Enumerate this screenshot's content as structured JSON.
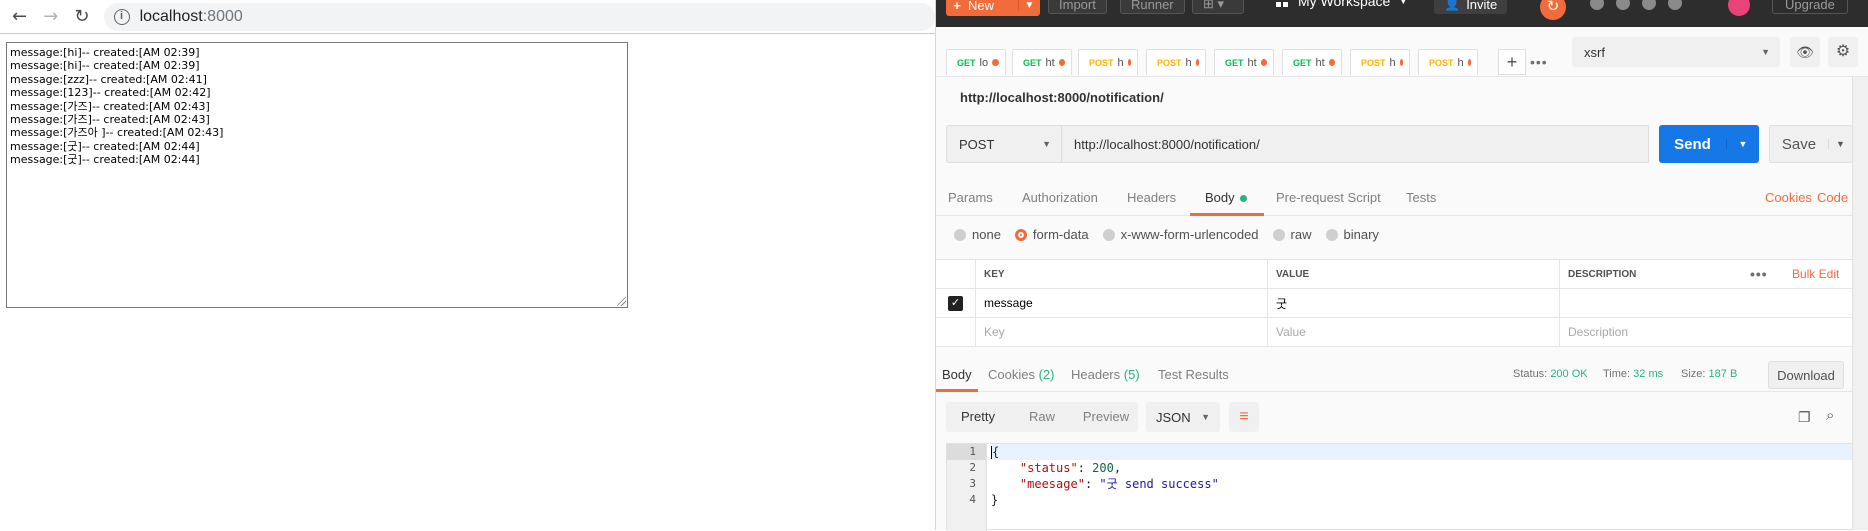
{
  "browser": {
    "url_host": "localhost",
    "url_port": ":8000",
    "messages": [
      "message:[hi]-- created:[AM 02:39]",
      "message:[hi]-- created:[AM 02:39]",
      "message:[zzz]-- created:[AM 02:41]",
      "message:[123]-- created:[AM 02:42]",
      "message:[가즈]-- created:[AM 02:43]",
      "message:[가즈]-- created:[AM 02:43]",
      "message:[가즈아 ]-- created:[AM 02:43]",
      "message:[굿]-- created:[AM 02:44]",
      "message:[굿]-- created:[AM 02:44]"
    ]
  },
  "postman": {
    "header": {
      "new_label": "New",
      "import_label": "Import",
      "runner_label": "Runner",
      "workspace_label": "My Workspace",
      "invite_label": "Invite",
      "upgrade_label": "Upgrade"
    },
    "tabs": [
      {
        "method": "GET",
        "title": "lo"
      },
      {
        "method": "GET",
        "title": "ht"
      },
      {
        "method": "POST",
        "title": "h"
      },
      {
        "method": "POST",
        "title": "h"
      },
      {
        "method": "GET",
        "title": "ht"
      },
      {
        "method": "GET",
        "title": "ht"
      },
      {
        "method": "POST",
        "title": "h"
      },
      {
        "method": "POST",
        "title": "h"
      }
    ],
    "environment": "xsrf",
    "request_name": "http://localhost:8000/notification/",
    "method": "POST",
    "url": "http://localhost:8000/notification/",
    "send_label": "Send",
    "save_label": "Save",
    "subtabs": {
      "params": "Params",
      "authorization": "Authorization",
      "headers": "Headers",
      "body": "Body",
      "prerequest": "Pre-request Script",
      "tests": "Tests",
      "cookies": "Cookies",
      "code": "Code"
    },
    "body_modes": {
      "none": "none",
      "form_data": "form-data",
      "urlencoded": "x-www-form-urlencoded",
      "raw": "raw",
      "binary": "binary"
    },
    "kv_table": {
      "head_key": "KEY",
      "head_value": "VALUE",
      "head_description": "DESCRIPTION",
      "bulk_edit": "Bulk Edit",
      "row_key": "message",
      "row_value": "굿",
      "placeholder_key": "Key",
      "placeholder_value": "Value",
      "placeholder_description": "Description"
    },
    "response": {
      "tab_body": "Body",
      "tab_cookies": "Cookies",
      "cookies_count": "(2)",
      "tab_headers": "Headers",
      "headers_count": "(5)",
      "tab_tests": "Test Results",
      "status_label": "Status:",
      "status_value": "200 OK",
      "time_label": "Time:",
      "time_value": "32 ms",
      "size_label": "Size:",
      "size_value": "187 B",
      "download_label": "Download",
      "view_pretty": "Pretty",
      "view_raw": "Raw",
      "view_preview": "Preview",
      "format": "JSON",
      "line_numbers": [
        "1",
        "2",
        "3",
        "4"
      ],
      "line1": "{",
      "line2_key": "\"status\"",
      "line2_val": "200",
      "line3_key": "\"meesage\"",
      "line3_val": "\"굿 send success\"",
      "line4": "}"
    }
  }
}
